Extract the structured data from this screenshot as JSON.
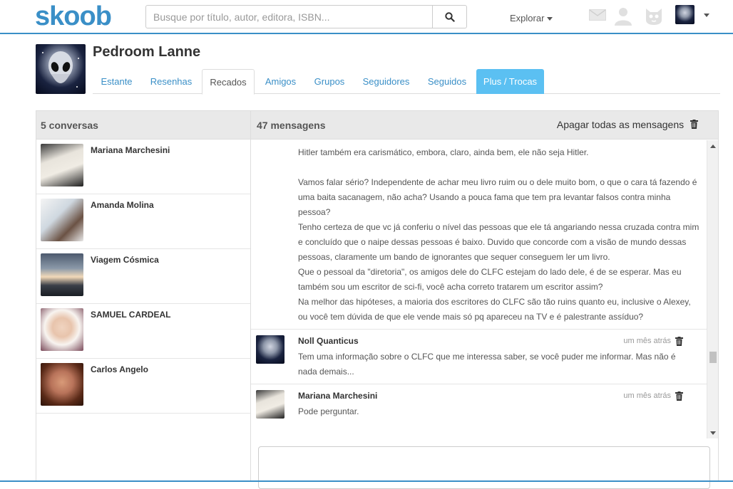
{
  "brand": {
    "logo": "skoob",
    "accent": "#3a8fc7"
  },
  "search": {
    "placeholder": "Busque por título, autor, editora, ISBN...",
    "icon": "search-icon"
  },
  "nav": {
    "explore": "Explorar",
    "icons": [
      "mail-icon",
      "user-icon",
      "cat-icon",
      "avatar"
    ]
  },
  "profile": {
    "name": "Pedroom Lanne",
    "tabs": [
      {
        "label": "Estante"
      },
      {
        "label": "Resenhas"
      },
      {
        "label": "Recados"
      },
      {
        "label": "Amigos"
      },
      {
        "label": "Grupos"
      },
      {
        "label": "Seguidores"
      },
      {
        "label": "Seguidos"
      },
      {
        "label": "Plus / Trocas"
      }
    ],
    "active_tab": "Recados"
  },
  "conversations": {
    "title": "5 conversas",
    "items": [
      {
        "name": "Mariana Marchesini"
      },
      {
        "name": "Amanda Molina"
      },
      {
        "name": "Viagem Cósmica"
      },
      {
        "name": "SAMUEL CARDEAL"
      },
      {
        "name": "Carlos Angelo"
      }
    ]
  },
  "messages": {
    "title": "47 mensagens",
    "delete_all": "Apagar todas as mensagens",
    "continued_text": [
      "Hitler também era carismático, embora, claro, ainda bem, ele não seja Hitler.",
      "",
      "Vamos falar sério? Independente de achar meu livro ruim ou o dele muito bom, o que o cara tá fazendo é uma baita sacanagem, não acha? Usando a pouca fama que tem pra levantar falsos contra minha pessoa?",
      "Tenho certeza de que vc já conferiu o nível das pessoas que ele tá angariando nessa cruzada contra mim e concluído que o naipe dessas pessoas é baixo. Duvido que concorde com a visão de mundo dessas pessoas, claramente um bando de ignorantes que sequer conseguem ler um livro.",
      "Que o pessoal da \"diretoria\", os amigos dele do CLFC estejam do lado dele, é de se esperar. Mas eu também sou um escritor de sci-fi, você acha correto tratarem um escritor assim?",
      "Na melhor das hipóteses, a maioria dos escritores do CLFC são tão ruins quanto eu, inclusive o Alexey, ou você tem dúvida de que ele vende mais só pq apareceu na TV e é palestrante assíduo?"
    ],
    "items": [
      {
        "from": "Noll Quanticus",
        "time": "um mês atrás",
        "text": "Tem uma informação sobre o CLFC que me interessa saber, se você puder me informar. Mas não é nada demais..."
      },
      {
        "from": "Mariana Marchesini",
        "time": "um mês atrás",
        "text": "Pode perguntar."
      }
    ]
  }
}
